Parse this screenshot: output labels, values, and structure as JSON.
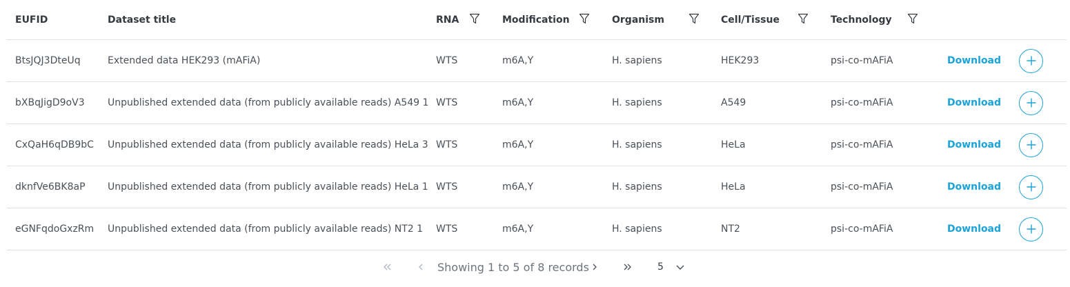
{
  "table": {
    "headers": {
      "eufid": "EUFID",
      "title": "Dataset title",
      "rna": "RNA",
      "modification": "Modification",
      "organism": "Organism",
      "cell_tissue": "Cell/Tissue",
      "technology": "Technology"
    },
    "rows": [
      {
        "eufid": "BtsJQJ3DteUq",
        "title": "Extended data HEK293 (mAFiA)",
        "rna": "WTS",
        "modification": "m6A,Y",
        "organism": "H. sapiens",
        "cell_tissue": "HEK293",
        "technology": "psi-co-mAFiA",
        "download": "Download"
      },
      {
        "eufid": "bXBqJigD9oV3",
        "title": "Unpublished extended data (from publicly available reads) A549 1",
        "rna": "WTS",
        "modification": "m6A,Y",
        "organism": "H. sapiens",
        "cell_tissue": "A549",
        "technology": "psi-co-mAFiA",
        "download": "Download"
      },
      {
        "eufid": "CxQaH6qDB9bC",
        "title": "Unpublished extended data (from publicly available reads) HeLa 3",
        "rna": "WTS",
        "modification": "m6A,Y",
        "organism": "H. sapiens",
        "cell_tissue": "HeLa",
        "technology": "psi-co-mAFiA",
        "download": "Download"
      },
      {
        "eufid": "dknfVe6BK8aP",
        "title": "Unpublished extended data (from publicly available reads) HeLa 1",
        "rna": "WTS",
        "modification": "m6A,Y",
        "organism": "H. sapiens",
        "cell_tissue": "HeLa",
        "technology": "psi-co-mAFiA",
        "download": "Download"
      },
      {
        "eufid": "eGNFqdoGxzRm",
        "title": "Unpublished extended data (from publicly available reads) NT2 1",
        "rna": "WTS",
        "modification": "m6A,Y",
        "organism": "H. sapiens",
        "cell_tissue": "NT2",
        "technology": "psi-co-mAFiA",
        "download": "Download"
      }
    ]
  },
  "icons": {
    "filter": "filter-icon",
    "add": "plus-circle-icon",
    "first": "double-chevron-left-icon",
    "prev": "chevron-left-icon",
    "next": "chevron-right-icon",
    "last": "double-chevron-right-icon",
    "dropdown": "chevron-down-icon"
  },
  "paginator": {
    "summary": "Showing 1 to 5 of 8 records",
    "page_size": "5"
  },
  "colors": {
    "accent": "#1aa3d9",
    "border": "#dee2e6",
    "muted": "#6c757d"
  }
}
